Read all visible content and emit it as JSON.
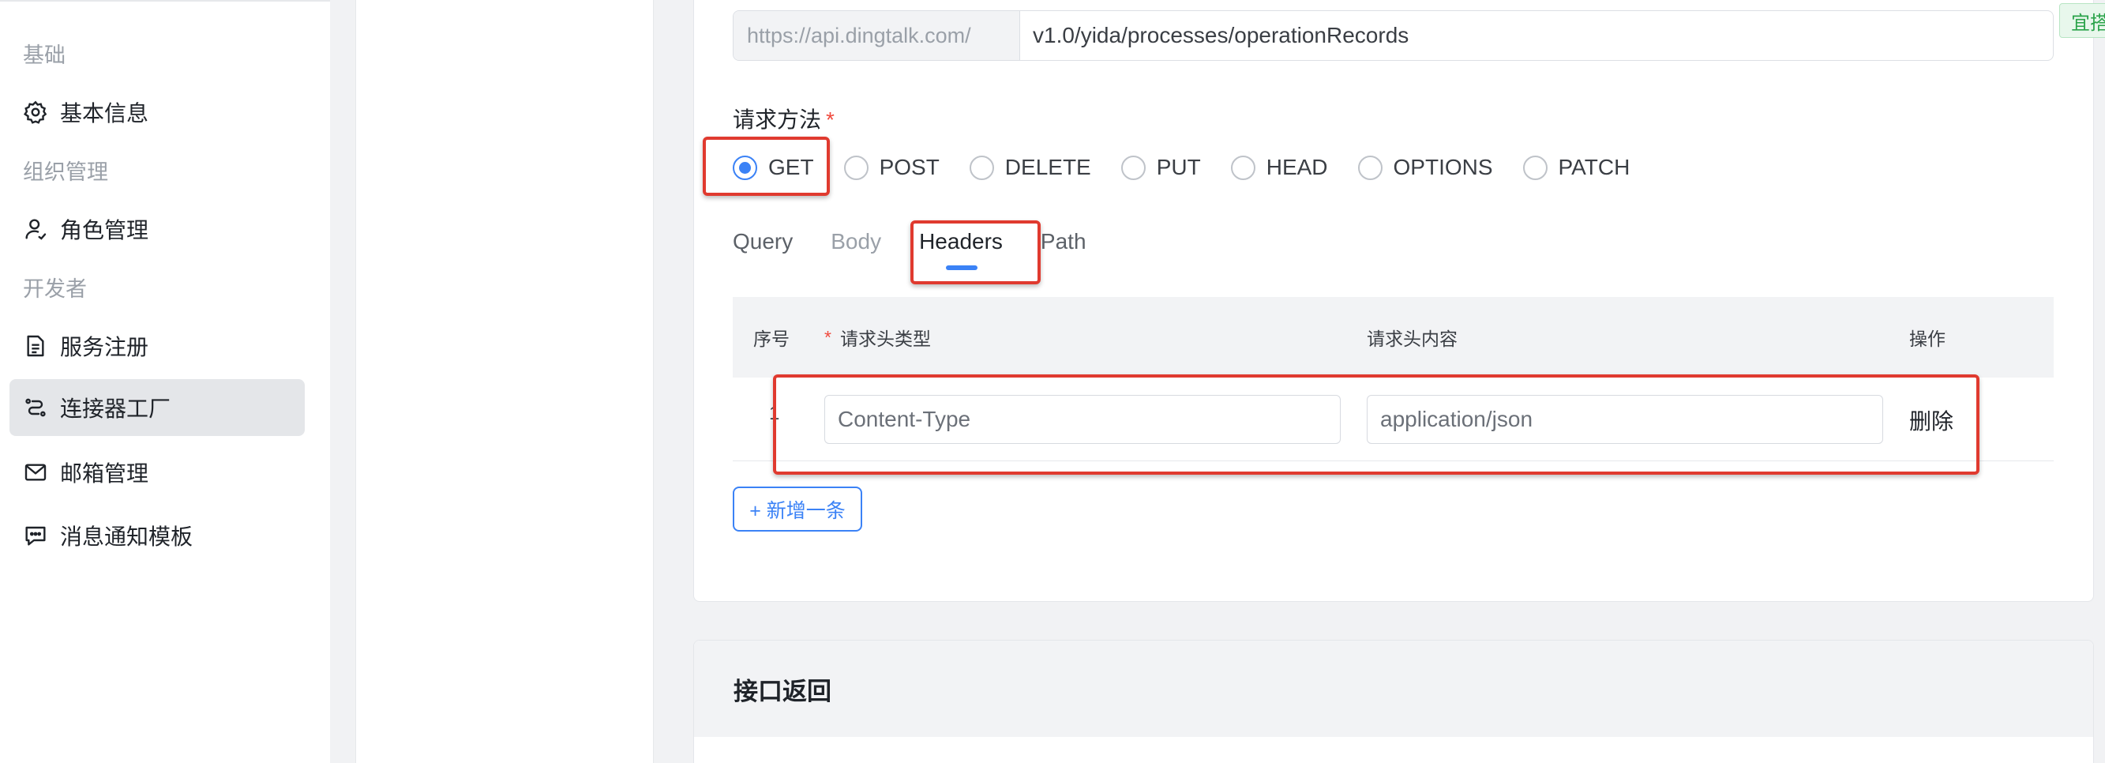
{
  "sidebar": {
    "groups": {
      "basic": "基础",
      "org": "组织管理",
      "developer": "开发者"
    },
    "items": [
      {
        "label": "基本信息",
        "icon": "gear-icon"
      },
      {
        "label": "角色管理",
        "icon": "user-role-icon"
      },
      {
        "label": "服务注册",
        "icon": "document-icon"
      },
      {
        "label": "连接器工厂",
        "icon": "connector-icon",
        "active": true
      },
      {
        "label": "邮箱管理",
        "icon": "mail-icon"
      },
      {
        "label": "消息通知模板",
        "icon": "message-icon"
      }
    ]
  },
  "form": {
    "url_prefix": "https://api.dingtalk.com/",
    "url_path": "v1.0/yida/processes/operationRecords",
    "corner_tag": "宜搭",
    "method_label": "请求方法",
    "required_mark": "*",
    "methods": [
      "GET",
      "POST",
      "DELETE",
      "PUT",
      "HEAD",
      "OPTIONS",
      "PATCH"
    ],
    "selected_method": "GET",
    "tabs": [
      "Query",
      "Body",
      "Headers",
      "Path"
    ],
    "active_tab": "Headers"
  },
  "headers_table": {
    "columns": {
      "index": "序号",
      "required_mark": "*",
      "type": "请求头类型",
      "content": "请求头内容",
      "action": "操作"
    },
    "rows": [
      {
        "index": "1",
        "type": "Content-Type",
        "content": "application/json",
        "action": "删除"
      }
    ],
    "add_button": "+ 新增一条"
  },
  "response_section": {
    "title": "接口返回"
  },
  "colors": {
    "accent": "#3b82f6",
    "annotation": "#e03a2f",
    "required": "#f04a3e"
  }
}
